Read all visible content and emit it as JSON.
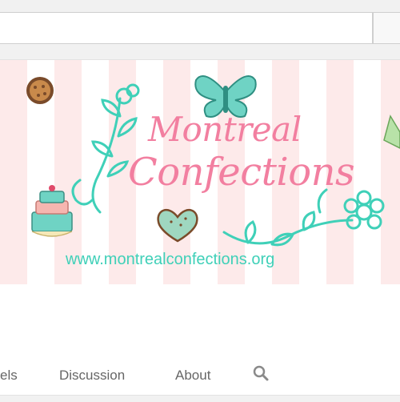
{
  "banner": {
    "title_line1": "Montreal",
    "title_line2": "Confections",
    "url": "www.montrealconfections.org"
  },
  "tabs": [
    {
      "label": "els"
    },
    {
      "label": "Discussion"
    },
    {
      "label": "About"
    }
  ],
  "icons": {
    "search": "search-icon"
  },
  "colors": {
    "pink": "#f27fa0",
    "mint": "#3fd0b8",
    "stripe": "#fdeaea"
  }
}
